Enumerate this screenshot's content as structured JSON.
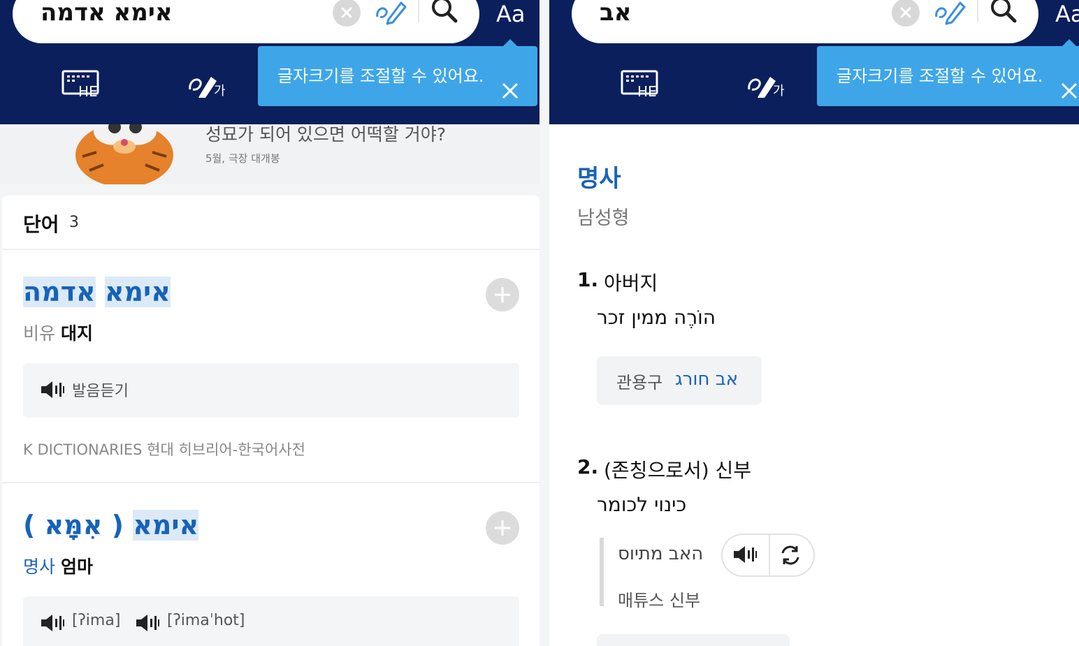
{
  "left": {
    "search": {
      "query": "אימא אדמה",
      "aa_label": "Aa"
    },
    "tooltip": {
      "text": "글자크기를 조절할 수 있어요."
    },
    "keyboard": {
      "label": "HE"
    },
    "handwriting": {
      "label": "가"
    },
    "banner": {
      "title": "성묘가 되어 있으면 어떡할 거야?",
      "subtitle": "5월, 극장 대개봉"
    },
    "words": {
      "title": "단어",
      "count": "3"
    },
    "entries": [
      {
        "title_parts": [
          "אימא",
          "אדמה"
        ],
        "tag": "비유",
        "meaning": "대지",
        "audio": [
          {
            "label": "발음듣기"
          }
        ],
        "source": "K DICTIONARIES 현대 히브리어-한국어사전"
      },
      {
        "title_parts": [
          "אימא",
          "( אִמָּא )"
        ],
        "tag": "명사",
        "meaning": "엄마",
        "audio": [
          {
            "label": "[ʔima]"
          },
          {
            "label": "[ʔimaˈhot]"
          }
        ]
      }
    ]
  },
  "right": {
    "search": {
      "query": "אב",
      "aa_label": "Aa"
    },
    "tooltip": {
      "text": "글자크기를 조절할 수 있어요."
    },
    "keyboard": {
      "label": "HE"
    },
    "handwriting": {
      "label": "가"
    },
    "pos": "명사",
    "gender": "남성형",
    "senses": [
      {
        "num": "1.",
        "text": "아버지",
        "hebrew": "הוֹרֶה ממין זכר"
      },
      {
        "num": "2.",
        "text": "(존칭으로서) 신부",
        "hebrew": "כינוי לכומר"
      }
    ],
    "idiom": {
      "label": "관용구",
      "text": "אב חורג"
    },
    "example": {
      "hebrew": "האב מתיוס",
      "korean": "매튜스 신부"
    }
  },
  "colors": {
    "header": "#0b1f5c",
    "tooltip": "#3ea6e8",
    "link": "#1b62b7",
    "highlight": "#dce9f7"
  }
}
